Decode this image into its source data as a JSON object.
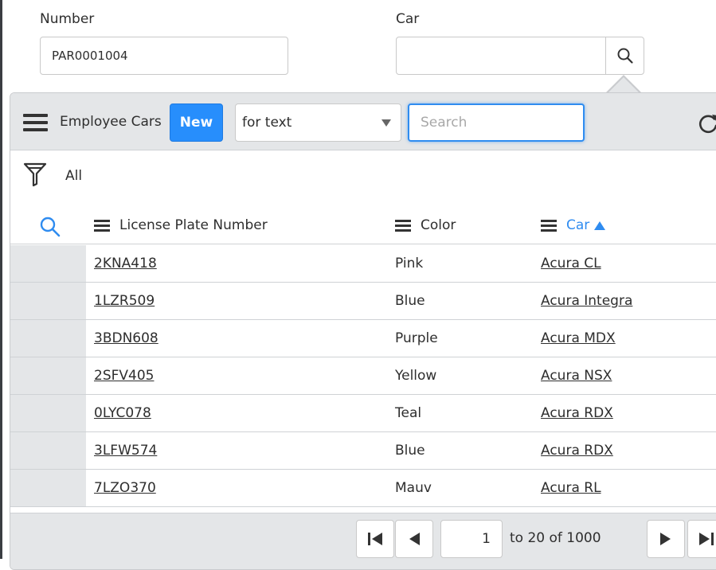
{
  "form": {
    "number_label": "Number",
    "number_value": "PAR0001004",
    "car_label": "Car",
    "car_value": ""
  },
  "list": {
    "title": "Employee Cars",
    "new_label": "New",
    "search_field_select": "for text",
    "search_placeholder": "Search",
    "filter_label": "All",
    "columns": [
      {
        "label": "License Plate Number"
      },
      {
        "label": "Color"
      },
      {
        "label": "Car"
      }
    ],
    "sorted_column": "Car",
    "sort_direction": "ascending",
    "rows": [
      {
        "plate": "2KNA418",
        "color": "Pink",
        "car": "Acura CL"
      },
      {
        "plate": "1LZR509",
        "color": "Blue",
        "car": "Acura Integra"
      },
      {
        "plate": "3BDN608",
        "color": "Purple",
        "car": "Acura MDX"
      },
      {
        "plate": "2SFV405",
        "color": "Yellow",
        "car": "Acura NSX"
      },
      {
        "plate": "0LYC078",
        "color": "Teal",
        "car": "Acura RDX"
      },
      {
        "plate": "3LFW574",
        "color": "Blue",
        "car": "Acura RDX"
      },
      {
        "plate": "7LZO370",
        "color": "Mauv",
        "car": "Acura RL"
      }
    ]
  },
  "pagination": {
    "current_page": "1",
    "range_text": "to 20 of 1000"
  },
  "icons": {
    "lookup": "search-icon",
    "menu": "hamburger-icon",
    "refresh": "refresh-icon",
    "filter": "funnel-icon",
    "column_search": "search-icon",
    "first": "first-page-icon",
    "prev": "previous-page-icon",
    "next": "next-page-icon",
    "last": "last-page-icon"
  },
  "colors": {
    "accent": "#278efc",
    "toolbar_bg": "#e4e6e8",
    "sort_active": "#2f8cf0"
  }
}
